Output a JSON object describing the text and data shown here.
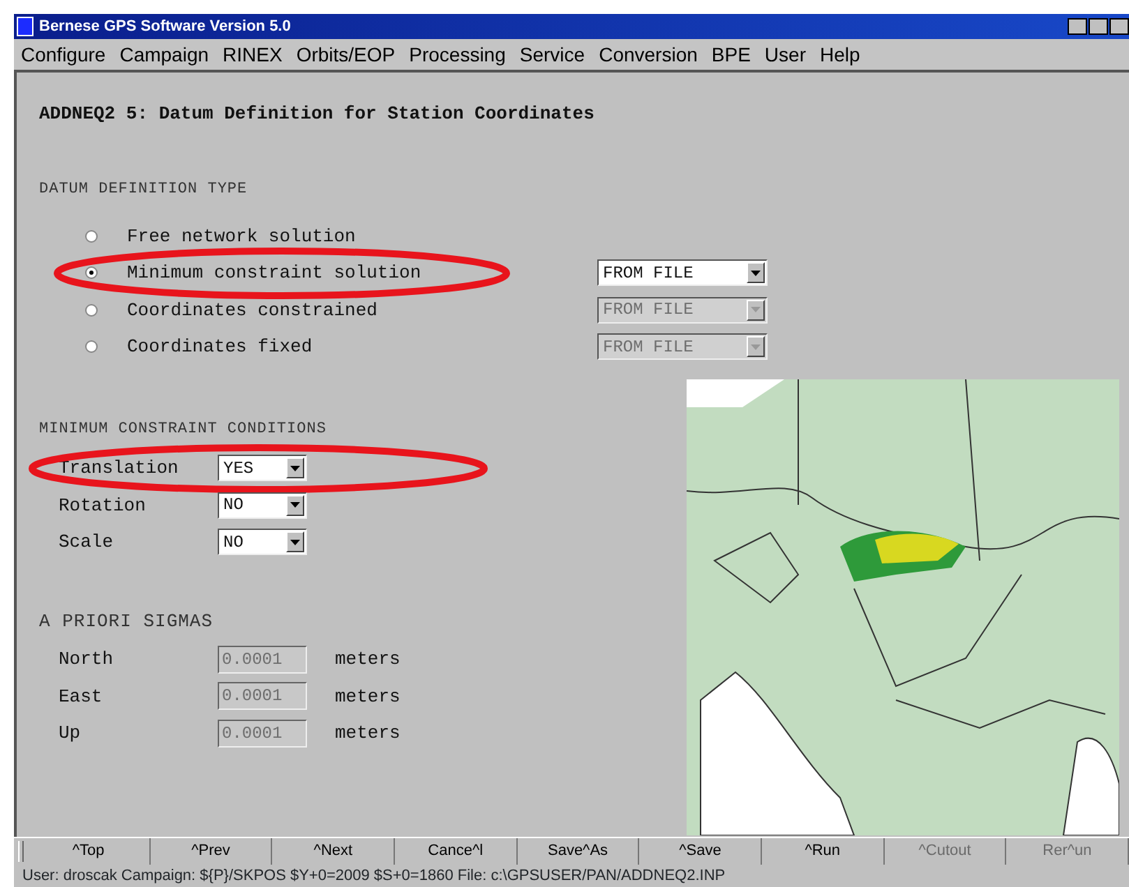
{
  "window": {
    "title": "Bernese GPS Software Version 5.0"
  },
  "menu": [
    "Configure",
    "Campaign",
    "RINEX",
    "Orbits/EOP",
    "Processing",
    "Service",
    "Conversion",
    "BPE",
    "User",
    "Help"
  ],
  "panel_title": "ADDNEQ2 5: Datum Definition for Station Coordinates",
  "datum_section": {
    "heading": "DATUM DEFINITION TYPE",
    "options": [
      {
        "label": "Free network solution",
        "selected": false,
        "highlighted": false
      },
      {
        "label": "Minimum constraint solution",
        "selected": true,
        "highlighted": true,
        "dropdown": {
          "value": "FROM FILE",
          "disabled": false
        }
      },
      {
        "label": "Coordinates constrained",
        "selected": false,
        "highlighted": false,
        "dropdown": {
          "value": "FROM FILE",
          "disabled": true
        }
      },
      {
        "label": "Coordinates fixed",
        "selected": false,
        "highlighted": false,
        "dropdown": {
          "value": "FROM FILE",
          "disabled": true
        }
      }
    ]
  },
  "conditions_section": {
    "heading": "MINIMUM CONSTRAINT CONDITIONS",
    "rows": [
      {
        "label": "Translation",
        "value": "YES",
        "highlighted": true
      },
      {
        "label": "Rotation",
        "value": "NO",
        "highlighted": false
      },
      {
        "label": "Scale",
        "value": "NO",
        "highlighted": false
      }
    ]
  },
  "sigmas_section": {
    "heading": "A PRIORI SIGMAS",
    "rows": [
      {
        "label": "North",
        "value": "0.0001",
        "unit": "meters",
        "disabled": true
      },
      {
        "label": "East",
        "value": "0.0001",
        "unit": "meters",
        "disabled": true
      },
      {
        "label": "Up",
        "value": "0.0001",
        "unit": "meters",
        "disabled": true
      }
    ]
  },
  "buttons": [
    {
      "label": "^Top",
      "disabled": false
    },
    {
      "label": "^Prev",
      "disabled": false
    },
    {
      "label": "^Next",
      "disabled": false
    },
    {
      "label": "Cance^l",
      "disabled": false
    },
    {
      "label": "Save^As",
      "disabled": false
    },
    {
      "label": "^Save",
      "disabled": false
    },
    {
      "label": "^Run",
      "disabled": false
    },
    {
      "label": "^Cutout",
      "disabled": true
    },
    {
      "label": "Rer^un",
      "disabled": true
    }
  ],
  "status_bar": "User: droscak  Campaign: ${P}/SKPOS   $Y+0=2009  $S+0=1860   File: c:\\GPSUSER/PAN/ADDNEQ2.INP"
}
